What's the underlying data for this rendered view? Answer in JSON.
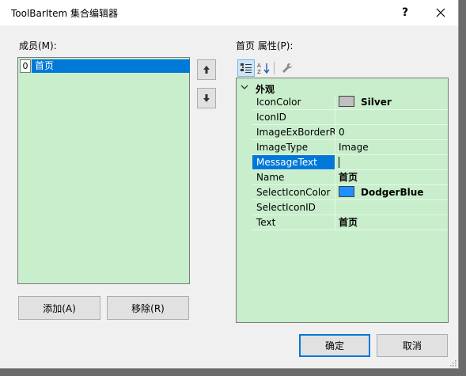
{
  "window": {
    "title": "ToolBarItem 集合编辑器",
    "help_label": "?",
    "close_label": "×"
  },
  "members": {
    "label": "成员(M):",
    "items": [
      {
        "index": "0",
        "name": "首页"
      }
    ]
  },
  "properties": {
    "label": "首页 属性(P):",
    "category": "外观",
    "rows": [
      {
        "name": "IconColor",
        "value": "Silver",
        "swatch": "#c0c0c0",
        "bold": true
      },
      {
        "name": "IconID",
        "value": ""
      },
      {
        "name": "ImageExBorderR",
        "value": "0"
      },
      {
        "name": "ImageType",
        "value": "Image"
      },
      {
        "name": "MessageText",
        "value": "",
        "selected": true
      },
      {
        "name": "Name",
        "value": "首页",
        "bold": true
      },
      {
        "name": "SelectIconColor",
        "value": "DodgerBlue",
        "swatch": "#1e90ff",
        "bold": true
      },
      {
        "name": "SelectIconID",
        "value": ""
      },
      {
        "name": "Text",
        "value": "首页",
        "bold": true
      }
    ]
  },
  "buttons": {
    "add": "添加(A)",
    "remove": "移除(R)",
    "ok": "确定",
    "cancel": "取消"
  },
  "colors": {
    "grid_background": "#c8eecb",
    "selection": "#0078d7",
    "dialog_background": "#f0f0f0"
  }
}
